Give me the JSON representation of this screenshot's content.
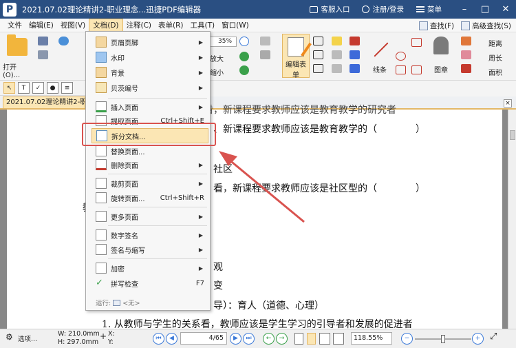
{
  "titlebar": {
    "logo": "P",
    "title": "2021.07.02理论精讲2-职业理念...迅捷PDF编辑器",
    "service": "客服入口",
    "login": "注册/登录",
    "menu": "菜单"
  },
  "menubar": {
    "items": [
      "文件",
      "编辑(E)",
      "视图(V)",
      "文档(D)",
      "注释(C)",
      "表单(R)",
      "工具(T)",
      "窗口(W)"
    ],
    "find": "查找(F)",
    "advanced_find": "高级查找(S)"
  },
  "toolbar": {
    "open": "打开(O)...",
    "zoom_value": "35%",
    "zoom_in": "放大",
    "zoom_out": "缩小",
    "edit_form": "编辑表单",
    "line": "线条",
    "stamp": "图章",
    "distance": "距离",
    "perimeter": "周长",
    "area": "面积"
  },
  "doc_tab": {
    "title": "2021.07.02理论精讲2-职业理",
    "close": "×"
  },
  "document": {
    "line1": "、新课程要求教师应该是教育教学的（　　　　）",
    "line2": "社区",
    "line3": "看，新课程要求教师应该是社区型的（　　　　）",
    "line4": "观",
    "line5": "变",
    "line6": "导）：育人（道德、心理）",
    "line7": "1. 从教师与学生的关系看，教师应该是学生学习的引导者和发展的促进者",
    "partial_top": "从教与研究的关系看，新课程要求教师应该是教育教学的研究者",
    "left_char": "教"
  },
  "dropdown": {
    "items": [
      {
        "label": "页眉页脚",
        "arrow": true
      },
      {
        "label": "水印",
        "arrow": true
      },
      {
        "label": "背景",
        "arrow": true
      },
      {
        "label": "贝茨编号",
        "arrow": true
      },
      {
        "label": "插入页面",
        "arrow": true
      },
      {
        "label": "提取页面...",
        "shortcut": "Ctrl+Shift+E"
      },
      {
        "label": "拆分文档...",
        "highlight": true
      },
      {
        "label": "替换页面..."
      },
      {
        "label": "删除页面",
        "arrow": true
      },
      {
        "label": "裁剪页面",
        "arrow": true
      },
      {
        "label": "旋转页面...",
        "shortcut": "Ctrl+Shift+R"
      },
      {
        "label": "更多页面",
        "arrow": true
      },
      {
        "label": "数字签名",
        "arrow": true
      },
      {
        "label": "签名与缩写",
        "arrow": true
      },
      {
        "label": "加密",
        "arrow": true
      },
      {
        "label": "拼写检查",
        "shortcut": "F7"
      }
    ],
    "run_label": "运行:",
    "run_value": "<无>"
  },
  "statusbar": {
    "options": "选项...",
    "width": "W: 210.0mm",
    "height": "H: 297.0mm",
    "x": "X:",
    "y": "Y:",
    "page": "4/65",
    "zoom": "118.55%"
  },
  "colors": {
    "titlebar": "#2a4f82",
    "highlight": "#fbe6b4",
    "highlight_border": "#e3b766",
    "annotation_red": "#d9534f"
  }
}
